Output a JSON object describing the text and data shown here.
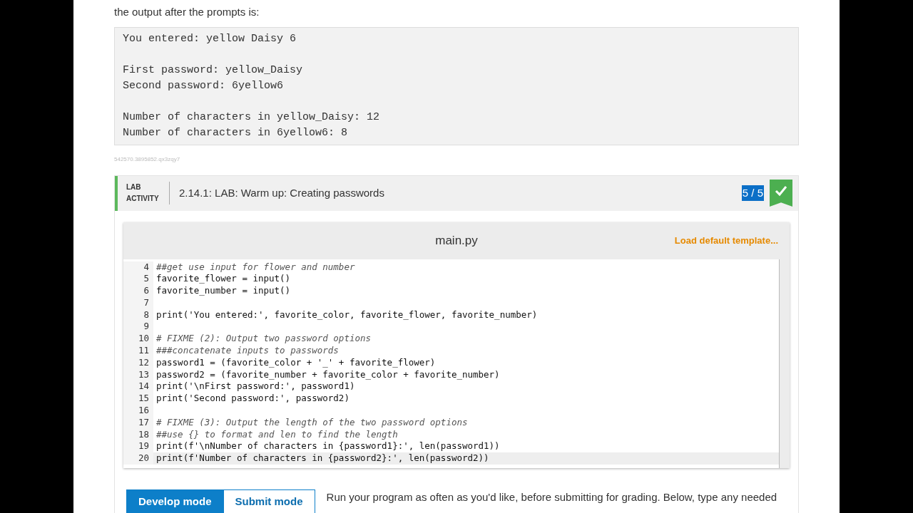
{
  "intro": "the output after the prompts is:",
  "output_blocks": [
    [
      "You entered: yellow Daisy 6"
    ],
    [
      "First password: yellow_Daisy",
      "Second password: 6yellow6"
    ],
    [
      "Number of characters in yellow_Daisy: 12",
      "Number of characters in 6yellow6: 8"
    ]
  ],
  "content_id": "542570.3895852.qx3zqy7",
  "lab": {
    "label": "LAB ACTIVITY",
    "title": "2.14.1: LAB: Warm up: Creating passwords",
    "score": "5 / 5",
    "score_selected": true,
    "complete": true
  },
  "editor": {
    "filename": "main.py",
    "template_link": "Load default template...",
    "lines": [
      {
        "number": "4",
        "kind": "comment",
        "text": "##get use input for flower and number",
        "current": false
      },
      {
        "number": "5",
        "kind": "code",
        "text": "favorite_flower = input()",
        "current": false
      },
      {
        "number": "6",
        "kind": "code",
        "text": "favorite_number = input()",
        "current": false
      },
      {
        "number": "7",
        "kind": "code",
        "current": false
      },
      {
        "number": "8",
        "kind": "code",
        "text": "print('You entered:', favorite_color, favorite_flower, favorite_number)",
        "current": false
      },
      {
        "number": "9",
        "kind": "code",
        "current": false
      },
      {
        "number": "10",
        "kind": "comment",
        "text": "# FIXME (2): Output two password options",
        "current": false
      },
      {
        "number": "11",
        "kind": "comment",
        "text": "###concatenate inputs to passwords",
        "current": false
      },
      {
        "number": "12",
        "kind": "code",
        "text": "password1 = (favorite_color + '_' + favorite_flower)",
        "current": false
      },
      {
        "number": "13",
        "kind": "code",
        "text": "password2 = (favorite_number + favorite_color + favorite_number)",
        "current": false
      },
      {
        "number": "14",
        "kind": "code",
        "text": "print('\\nFirst password:', password1)",
        "current": false
      },
      {
        "number": "15",
        "kind": "code",
        "text": "print('Second password:', password2)",
        "current": false
      },
      {
        "number": "16",
        "kind": "code",
        "current": false
      },
      {
        "number": "17",
        "kind": "comment",
        "text": "# FIXME (3): Output the length of the two password options",
        "current": false
      },
      {
        "number": "18",
        "kind": "comment",
        "text": "##use {} to format and len to find the length",
        "current": false
      },
      {
        "number": "19",
        "kind": "code",
        "text": "print(f'\\nNumber of characters in {password1}:', len(password1))",
        "current": false
      },
      {
        "number": "20",
        "kind": "code",
        "text": "print(f'Number of characters in {password2}:', len(password2))",
        "current": true
      }
    ]
  },
  "modes": [
    {
      "label": "Develop mode",
      "selected": true
    },
    {
      "label": "Submit mode",
      "selected": false
    }
  ],
  "instructions": "Run your program as often as you'd like, before submitting for grading. Below, type any needed"
}
